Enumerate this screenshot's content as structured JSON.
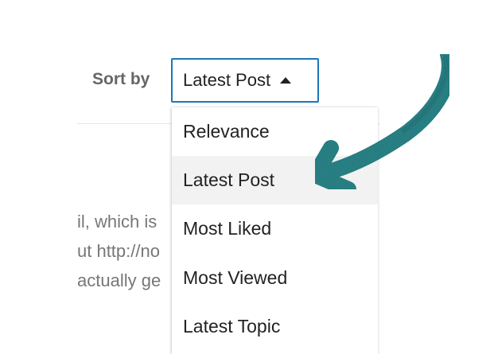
{
  "sort": {
    "label": "Sort by",
    "selected_value": "Latest Post"
  },
  "dropdown": {
    "options": [
      {
        "label": "Relevance"
      },
      {
        "label": "Latest Post",
        "selected": true
      },
      {
        "label": "Most Liked"
      },
      {
        "label": "Most Viewed"
      },
      {
        "label": "Latest Topic"
      }
    ]
  },
  "background_text": {
    "line1": "il, which is",
    "line2": "ut http://no",
    "line3": "actually ge"
  },
  "colors": {
    "accent_border": "#1b78b5",
    "arrow": "#1a6e72",
    "selected_bg": "#f2f2f2"
  },
  "icons": {
    "select_caret": "caret-up-icon",
    "annotation": "curved-arrow-icon"
  }
}
